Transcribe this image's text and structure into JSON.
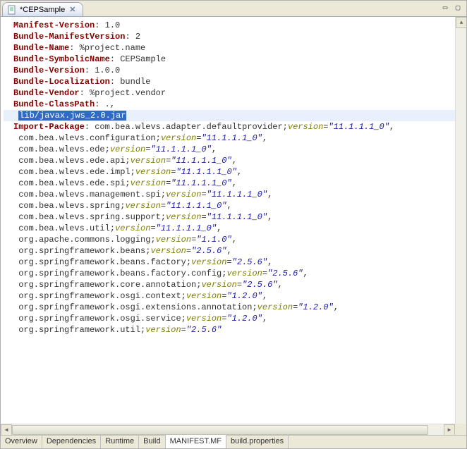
{
  "tab": {
    "title": "*CEPSample"
  },
  "manifest": {
    "headers": [
      {
        "key": "Manifest-Version",
        "value": "1.0"
      },
      {
        "key": "Bundle-ManifestVersion",
        "value": "2"
      },
      {
        "key": "Bundle-Name",
        "value": "%project.name"
      },
      {
        "key": "Bundle-SymbolicName",
        "value": "CEPSample"
      },
      {
        "key": "Bundle-Version",
        "value": "1.0.0"
      },
      {
        "key": "Bundle-Localization",
        "value": "bundle"
      },
      {
        "key": "Bundle-Vendor",
        "value": "%project.vendor"
      }
    ],
    "classpath_key": "Bundle-ClassPath",
    "classpath_first": ".,",
    "classpath_selected": "lib/javax.jws_2.0.jar",
    "import_key": "Import-Package",
    "import_first": {
      "pkg": "com.bea.wlevs.adapter.defaultprovider",
      "ver": "11.1.1.1_0"
    },
    "imports": [
      {
        "pkg": "com.bea.wlevs.configuration",
        "ver": "11.1.1.1_0"
      },
      {
        "pkg": "com.bea.wlevs.ede",
        "ver": "11.1.1.1_0"
      },
      {
        "pkg": "com.bea.wlevs.ede.api",
        "ver": "11.1.1.1_0"
      },
      {
        "pkg": "com.bea.wlevs.ede.impl",
        "ver": "11.1.1.1_0"
      },
      {
        "pkg": "com.bea.wlevs.ede.spi",
        "ver": "11.1.1.1_0"
      },
      {
        "pkg": "com.bea.wlevs.management.spi",
        "ver": "11.1.1.1_0"
      },
      {
        "pkg": "com.bea.wlevs.spring",
        "ver": "11.1.1.1_0"
      },
      {
        "pkg": "com.bea.wlevs.spring.support",
        "ver": "11.1.1.1_0"
      },
      {
        "pkg": "com.bea.wlevs.util",
        "ver": "11.1.1.1_0"
      },
      {
        "pkg": "org.apache.commons.logging",
        "ver": "1.1.0"
      },
      {
        "pkg": "org.springframework.beans",
        "ver": "2.5.6"
      },
      {
        "pkg": "org.springframework.beans.factory",
        "ver": "2.5.6"
      },
      {
        "pkg": "org.springframework.beans.factory.config",
        "ver": "2.5.6"
      },
      {
        "pkg": "org.springframework.core.annotation",
        "ver": "2.5.6"
      },
      {
        "pkg": "org.springframework.osgi.context",
        "ver": "1.2.0"
      },
      {
        "pkg": "org.springframework.osgi.extensions.annotation",
        "ver": "1.2.0"
      },
      {
        "pkg": "org.springframework.osgi.service",
        "ver": "1.2.0"
      },
      {
        "pkg": "org.springframework.util",
        "ver": "2.5.6"
      }
    ]
  },
  "bottom_tabs": {
    "items": [
      "Overview",
      "Dependencies",
      "Runtime",
      "Build",
      "MANIFEST.MF",
      "build.properties"
    ],
    "active": 4
  }
}
